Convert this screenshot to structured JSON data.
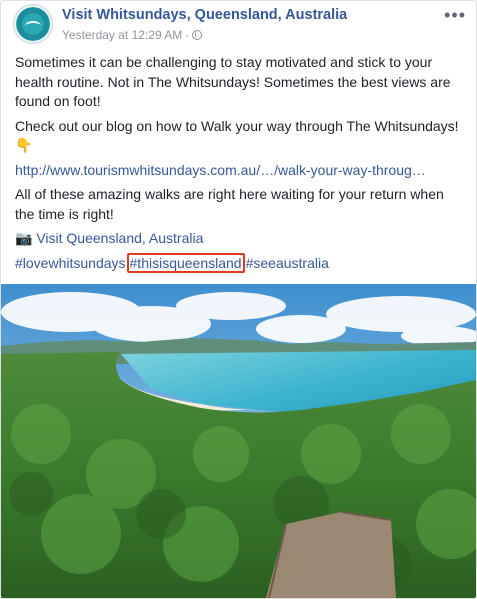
{
  "post": {
    "author": "Visit Whitsundays, Queensland, Australia",
    "timestamp": "Yesterday at 12:29 AM",
    "separator": "·",
    "more_label": "•••",
    "paragraphs": [
      "Sometimes it can be challenging to stay motivated and stick to your health routine. Not in The Whitsundays! Sometimes the best views are found on foot!",
      "Check out our blog on how to Walk your way through The Whitsundays! 👇"
    ],
    "link": "http://www.tourismwhitsundays.com.au/…/walk-your-way-throug…",
    "closing": "All of these amazing walks are right here waiting for your return when the time is right!",
    "camera_emoji": "📷",
    "location_tag": "Visit Queensland, Australia",
    "hashtags": [
      "#lovewhitsundays",
      "#thisisqueensland",
      "#seeaustralia"
    ]
  },
  "colors": {
    "link_blue": "#365899",
    "highlight_red": "#e03a1f",
    "meta_gray": "#90949c"
  },
  "icons": [
    "page-avatar-logo",
    "globe-icon",
    "more-options-icon"
  ]
}
